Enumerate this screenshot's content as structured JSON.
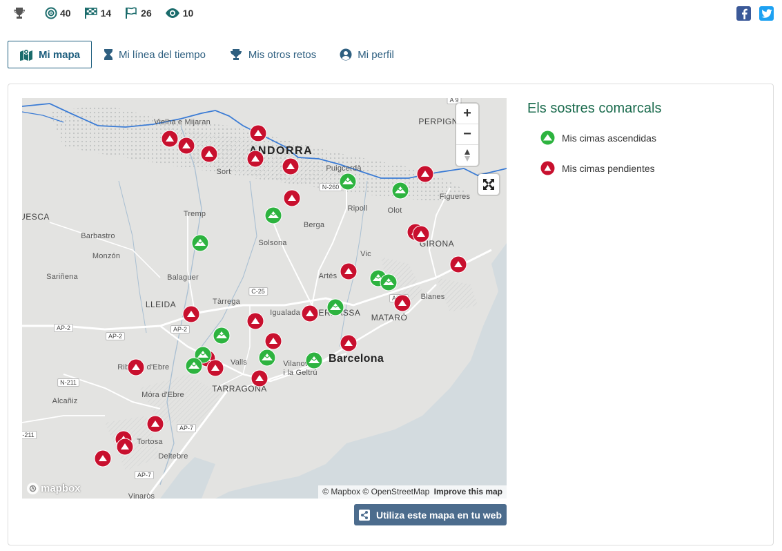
{
  "stats": {
    "trophy_icon": "trophy-icon",
    "target_count": "40",
    "checkered_count": "14",
    "flag_count": "26",
    "eye_count": "10"
  },
  "social": {
    "facebook_icon": "facebook-icon",
    "twitter_icon": "twitter-icon"
  },
  "tabs": [
    {
      "label": "Mi mapa",
      "icon": "map-icon",
      "active": true
    },
    {
      "label": "Mi línea del tiempo",
      "icon": "hourglass-icon",
      "active": false
    },
    {
      "label": "Mis otros retos",
      "icon": "trophy-icon",
      "active": false
    },
    {
      "label": "Mi perfil",
      "icon": "user-icon",
      "active": false
    }
  ],
  "map": {
    "labels": {
      "andorra": "ANDORRA",
      "barcelona": "Barcelona",
      "perpignan": "PERPIGNAN",
      "girona": "GIRONA",
      "lleida": "LLEIDA",
      "tarragona": "TARRAGONA",
      "mataro": "MATARÓ",
      "terrassa": "TERRASSA",
      "huesca": "UESCA",
      "vielha": "Vielha e Mijaran",
      "sort": "Sort",
      "puigcerda": "Puigcerdà",
      "tremp": "Tremp",
      "ripoll": "Ripoll",
      "olot": "Olot",
      "figueres": "Figueres",
      "berga": "Berga",
      "solsona": "Solsona",
      "barbastro": "Barbastro",
      "monzon": "Monzón",
      "vic": "Vic",
      "sarinena": "Sariñena",
      "balaguer": "Balaguer",
      "artes": "Artés",
      "blanes": "Blanes",
      "tarrega": "Tàrrega",
      "igualada": "Igualada",
      "valls": "Valls",
      "vilanova": "Vilanova",
      "vilanova2": "i la Geltrú",
      "riba": "Riba",
      "debre": "d'Ebre",
      "mora": "Móra d'Ebre",
      "alcaniz": "Alcañiz",
      "tortosa": "Tortosa",
      "deltebre": "Deltebre",
      "vinaros": "Vinaròs"
    },
    "roads": {
      "a9": "A 9",
      "n260": "N-260",
      "c25": "C-25",
      "ap2a": "AP-2",
      "ap2b": "AP-2",
      "ap2c": "AP-2",
      "n211": "N-211",
      "n211b": "-211",
      "ap7a": "AP-7",
      "ap7b": "AP-7",
      "ap7c": "AP-7"
    },
    "zoom_in": "+",
    "zoom_out": "−",
    "attribution_1": "© Mapbox © OpenStreetMap",
    "attribution_2": "Improve this map",
    "mapbox_logo": "mapbox"
  },
  "embed_button": "Utiliza este mapa en tu web",
  "legend": {
    "title": "Els sostres comarcals",
    "ascended": "Mis cimas ascendidas",
    "pending": "Mis cimas pendientes",
    "ascended_color": "#2db33f",
    "pending_color": "#c8102e"
  }
}
